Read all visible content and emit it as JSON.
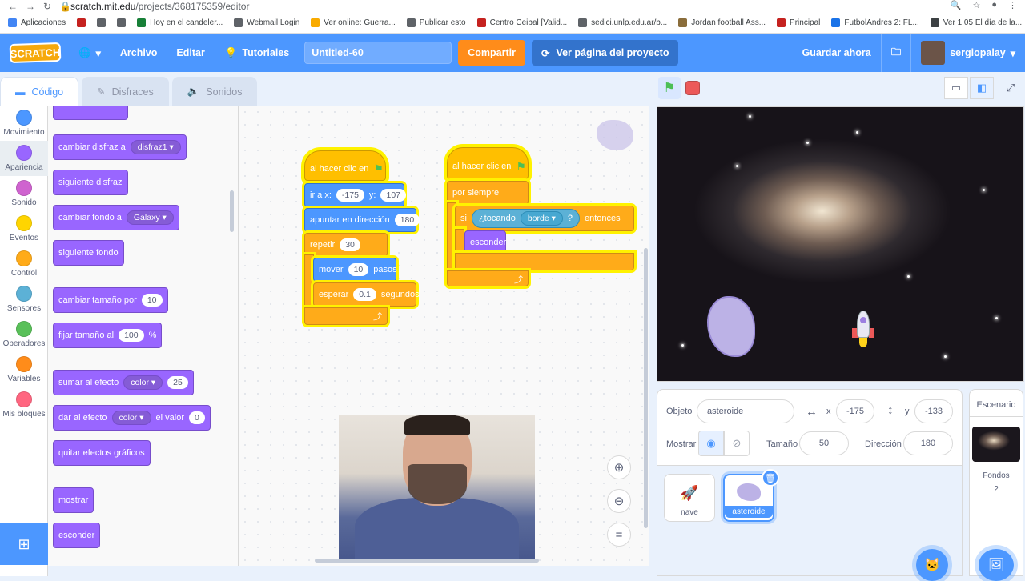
{
  "browser": {
    "url_host": "scratch.mit.edu",
    "url_path": "/projects/368175359/editor",
    "bookmarks": [
      {
        "label": "Aplicaciones",
        "color": "#4285f4"
      },
      {
        "label": "",
        "color": "#c5221f"
      },
      {
        "label": "",
        "color": "#5f6368"
      },
      {
        "label": "",
        "color": "#5f6368"
      },
      {
        "label": "Hoy en el candeler...",
        "color": "#188038"
      },
      {
        "label": "Webmail Login",
        "color": "#5f6368"
      },
      {
        "label": "Ver online: Guerra...",
        "color": "#f9ab00"
      },
      {
        "label": "Publicar esto",
        "color": "#5f6368"
      },
      {
        "label": "Centro Ceibal [Valid...",
        "color": "#c5221f"
      },
      {
        "label": "sedici.unlp.edu.ar/b...",
        "color": "#5f6368"
      },
      {
        "label": "Jordan football Ass...",
        "color": "#8a6d3b"
      },
      {
        "label": "Principal",
        "color": "#c5221f"
      },
      {
        "label": "FutbolAndres 2: FL...",
        "color": "#1a73e8"
      },
      {
        "label": "Ver 1.05 El día de la...",
        "color": "#3c4043"
      }
    ]
  },
  "menubar": {
    "logo": "SCRATCH",
    "file": "Archivo",
    "edit": "Editar",
    "tutorials": "Tutoriales",
    "project_title": "Untitled-60",
    "share": "Compartir",
    "see_project": "Ver página del proyecto",
    "save_now": "Guardar ahora",
    "username": "sergiopalay"
  },
  "tabs": {
    "code": "Código",
    "costumes": "Disfraces",
    "sounds": "Sonidos"
  },
  "categories": [
    {
      "label": "Movimiento",
      "color": "#4c97ff"
    },
    {
      "label": "Apariencia",
      "color": "#9966ff"
    },
    {
      "label": "Sonido",
      "color": "#cf63cf"
    },
    {
      "label": "Eventos",
      "color": "#ffd500"
    },
    {
      "label": "Control",
      "color": "#ffab19"
    },
    {
      "label": "Sensores",
      "color": "#5cb1d6"
    },
    {
      "label": "Operadores",
      "color": "#59c059"
    },
    {
      "label": "Variables",
      "color": "#ff8c1a"
    },
    {
      "label": "Mis bloques",
      "color": "#ff6680"
    }
  ],
  "palette": {
    "switch_costume": "cambiar disfraz a",
    "costume_value": "disfraz1",
    "next_costume": "siguiente disfraz",
    "switch_backdrop": "cambiar fondo a",
    "backdrop_value": "Galaxy",
    "next_backdrop": "siguiente fondo",
    "change_size": "cambiar tamaño por",
    "change_size_value": "10",
    "set_size": "fijar tamaño al",
    "set_size_value": "100",
    "set_size_unit": "%",
    "change_effect": "sumar al efecto",
    "change_effect_name": "color",
    "change_effect_value": "25",
    "set_effect": "dar al efecto",
    "set_effect_name": "color",
    "set_effect_mid": "el valor",
    "set_effect_value": "0",
    "clear_effects": "quitar efectos gráficos",
    "show": "mostrar",
    "hide": "esconder"
  },
  "script1": {
    "hat": "al hacer clic en",
    "goto": "ir a x:",
    "goto_x": "-175",
    "goto_y_label": "y:",
    "goto_y": "107",
    "point": "apuntar en dirección",
    "point_value": "180",
    "repeat": "repetir",
    "repeat_value": "30",
    "move": "mover",
    "move_value": "10",
    "move_unit": "pasos",
    "wait": "esperar",
    "wait_value": "0.1",
    "wait_unit": "segundos"
  },
  "script2": {
    "hat": "al hacer clic en",
    "forever": "por siempre",
    "if": "si",
    "touching": "¿tocando",
    "touching_value": "borde",
    "question": "?",
    "then": "entonces",
    "hide": "esconder"
  },
  "sprite": {
    "object_label": "Objeto",
    "name": "asteroide",
    "x_label": "x",
    "x": "-175",
    "y_label": "y",
    "y": "-133",
    "show_label": "Mostrar",
    "size_label": "Tamaño",
    "size": "50",
    "direction_label": "Dirección",
    "direction": "180"
  },
  "sprites": [
    {
      "name": "nave"
    },
    {
      "name": "asteroide"
    }
  ],
  "stage_pane": {
    "title": "Escenario",
    "backdrops_label": "Fondos",
    "backdrops_count": "2"
  }
}
